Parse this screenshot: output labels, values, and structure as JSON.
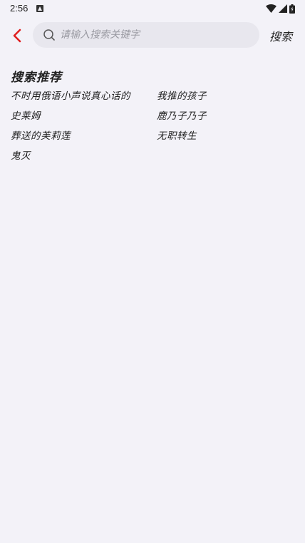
{
  "status_bar": {
    "time": "2:56",
    "notification_icon": "android-notification-icon",
    "wifi_icon": "wifi-icon",
    "signal_icon": "signal-icon",
    "battery_icon": "battery-icon"
  },
  "toolbar": {
    "back_icon": "chevron-left-icon",
    "back_color": "#e02020",
    "search_placeholder": "请输入搜索关键字",
    "search_value": "",
    "search_button_label": "搜索"
  },
  "recommendations": {
    "title": "搜索推荐",
    "items": [
      {
        "label": "不时用俄语小声说真心话的"
      },
      {
        "label": "我推的孩子"
      },
      {
        "label": "史莱姆"
      },
      {
        "label": "鹿乃子乃子"
      },
      {
        "label": "葬送的芙莉莲"
      },
      {
        "label": "无职转生"
      },
      {
        "label": "鬼灭"
      }
    ]
  }
}
